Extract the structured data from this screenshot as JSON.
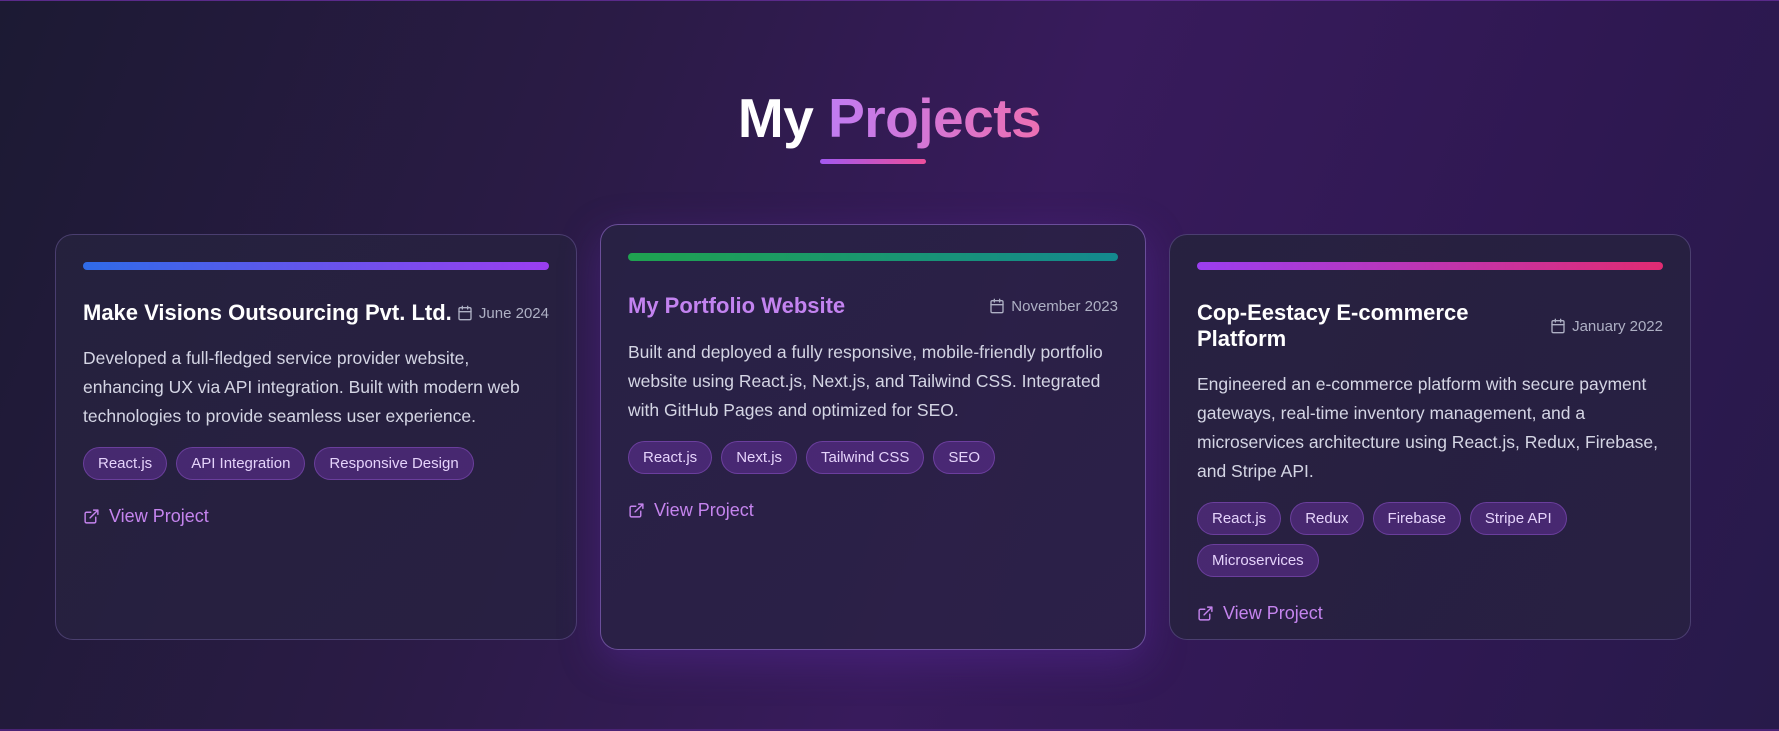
{
  "header": {
    "title_plain": "My",
    "title_accent": "Projects"
  },
  "projects": [
    {
      "title": "Make Visions Outsourcing Pvt. Ltd.",
      "date": "June 2024",
      "description": "Developed a full-fledged service provider website, enhancing UX via API integration. Built with modern web technologies to provide seamless user experience.",
      "tags": [
        "React.js",
        "API Integration",
        "Responsive Design"
      ],
      "link_label": "View Project",
      "bar_colors": [
        "#2f6be8",
        "#9b3ef0"
      ]
    },
    {
      "title": "My Portfolio Website",
      "date": "November 2023",
      "description": "Built and deployed a fully responsive, mobile-friendly portfolio website using React.js, Next.js, and Tailwind CSS. Integrated with GitHub Pages and optimized for SEO.",
      "tags": [
        "React.js",
        "Next.js",
        "Tailwind CSS",
        "SEO"
      ],
      "link_label": "View Project",
      "bar_colors": [
        "#1fa350",
        "#14898f"
      ]
    },
    {
      "title": "Cop-Eestacy E-commerce Platform",
      "date": "January 2022",
      "description": "Engineered an e-commerce platform with secure payment gateways, real-time inventory management, and a microservices architecture using React.js, Redux, Firebase, and Stripe API.",
      "tags": [
        "React.js",
        "Redux",
        "Firebase",
        "Stripe API",
        "Microservices"
      ],
      "link_label": "View Project",
      "bar_colors": [
        "#9b3ef0",
        "#e12b72"
      ]
    }
  ],
  "icons": {
    "date": "calendar-icon",
    "link": "external-link-icon"
  }
}
